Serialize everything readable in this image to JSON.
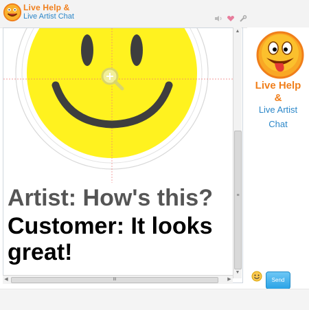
{
  "header": {
    "brand_line1": "Live Help &",
    "brand_line2": "Live Artist Chat",
    "icons": [
      "speaker-icon",
      "heart-icon",
      "wrench-icon"
    ]
  },
  "chat": {
    "messages": [
      {
        "speaker": "Artist",
        "text": "Artist: How's this?"
      },
      {
        "speaker": "Customer",
        "text": "Customer: It looks great!"
      }
    ],
    "canvas_content": "smiley-face-drawing"
  },
  "side_panel": {
    "title_line1": "Live Help",
    "title_line2": "&",
    "title_line3": "Live Artist",
    "title_line4": "Chat"
  },
  "scroll": {
    "h_center_mark": "III",
    "v_center_mark": "≡"
  },
  "send_label": "Send",
  "colors": {
    "brand_orange": "#f07e1a",
    "brand_blue": "#2a86c8",
    "smiley_yellow": "#fff21f",
    "send_blue": "#2aa3e6"
  }
}
